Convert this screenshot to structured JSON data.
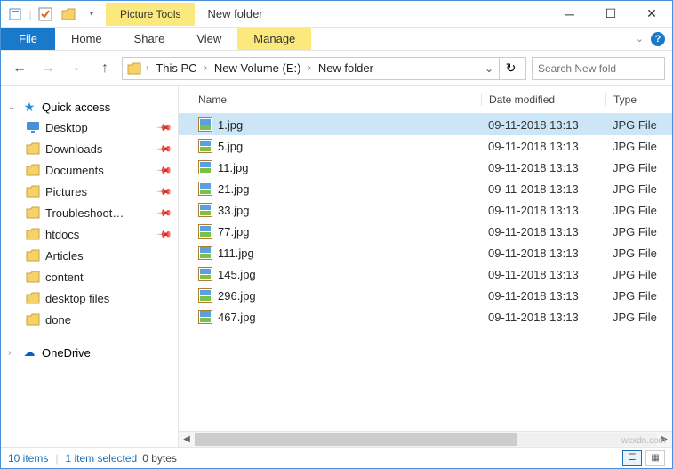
{
  "window": {
    "title": "New folder",
    "contextual_tab": "Picture Tools"
  },
  "ribbon": {
    "file": "File",
    "tabs": [
      "Home",
      "Share",
      "View"
    ],
    "manage": "Manage"
  },
  "breadcrumbs": [
    "This PC",
    "New Volume (E:)",
    "New folder"
  ],
  "search": {
    "placeholder": "Search New fold"
  },
  "tree": {
    "quick_access": "Quick access",
    "items": [
      {
        "label": "Desktop",
        "pinned": true,
        "icon": "desktop"
      },
      {
        "label": "Downloads",
        "pinned": true,
        "icon": "folder"
      },
      {
        "label": "Documents",
        "pinned": true,
        "icon": "folder"
      },
      {
        "label": "Pictures",
        "pinned": true,
        "icon": "folder"
      },
      {
        "label": "Troubleshoot…",
        "pinned": true,
        "icon": "folder"
      },
      {
        "label": "htdocs",
        "pinned": true,
        "icon": "folder"
      },
      {
        "label": "Articles",
        "pinned": false,
        "icon": "folder"
      },
      {
        "label": "content",
        "pinned": false,
        "icon": "folder"
      },
      {
        "label": "desktop files",
        "pinned": false,
        "icon": "folder"
      },
      {
        "label": "done",
        "pinned": false,
        "icon": "folder"
      }
    ],
    "onedrive": "OneDrive"
  },
  "columns": {
    "name": "Name",
    "date": "Date modified",
    "type": "Type"
  },
  "files": [
    {
      "name": "1.jpg",
      "date": "09-11-2018 13:13",
      "type": "JPG File",
      "selected": true
    },
    {
      "name": "5.jpg",
      "date": "09-11-2018 13:13",
      "type": "JPG File",
      "selected": false
    },
    {
      "name": "11.jpg",
      "date": "09-11-2018 13:13",
      "type": "JPG File",
      "selected": false
    },
    {
      "name": "21.jpg",
      "date": "09-11-2018 13:13",
      "type": "JPG File",
      "selected": false
    },
    {
      "name": "33.jpg",
      "date": "09-11-2018 13:13",
      "type": "JPG File",
      "selected": false
    },
    {
      "name": "77.jpg",
      "date": "09-11-2018 13:13",
      "type": "JPG File",
      "selected": false
    },
    {
      "name": "111.jpg",
      "date": "09-11-2018 13:13",
      "type": "JPG File",
      "selected": false
    },
    {
      "name": "145.jpg",
      "date": "09-11-2018 13:13",
      "type": "JPG File",
      "selected": false
    },
    {
      "name": "296.jpg",
      "date": "09-11-2018 13:13",
      "type": "JPG File",
      "selected": false
    },
    {
      "name": "467.jpg",
      "date": "09-11-2018 13:13",
      "type": "JPG File",
      "selected": false
    }
  ],
  "status": {
    "count": "10 items",
    "selected": "1 item selected",
    "size": "0 bytes"
  },
  "watermark": "wsxdn.com"
}
